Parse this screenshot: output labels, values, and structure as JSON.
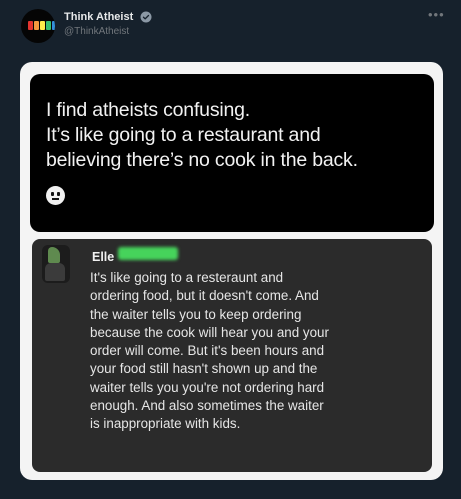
{
  "tweet": {
    "author_name": "Think Atheist",
    "author_handle": "@ThinkAtheist",
    "verified": true,
    "logo_colors": [
      "#e3342f",
      "#f6993f",
      "#ffed4a",
      "#38c172",
      "#3490dc"
    ]
  },
  "media": {
    "top_lines": [
      "I find atheists confusing.",
      "It’s like going to a restaurant and",
      "believing there’s no cook in the back."
    ],
    "emoji": "neutral-face-icon",
    "reply": {
      "name": "Elle",
      "name_redacted": true,
      "lines": [
        "It's like going to a resteraunt and",
        "ordering food, but it doesn't come. And",
        "the waiter tells you to keep ordering",
        "because the cook will hear you and your",
        "order will come. But it's been hours and",
        "your food still hasn't shown up and the",
        "waiter tells you you're not ordering hard",
        "enough. And also sometimes the waiter",
        "is inappropriate with kids."
      ]
    }
  }
}
